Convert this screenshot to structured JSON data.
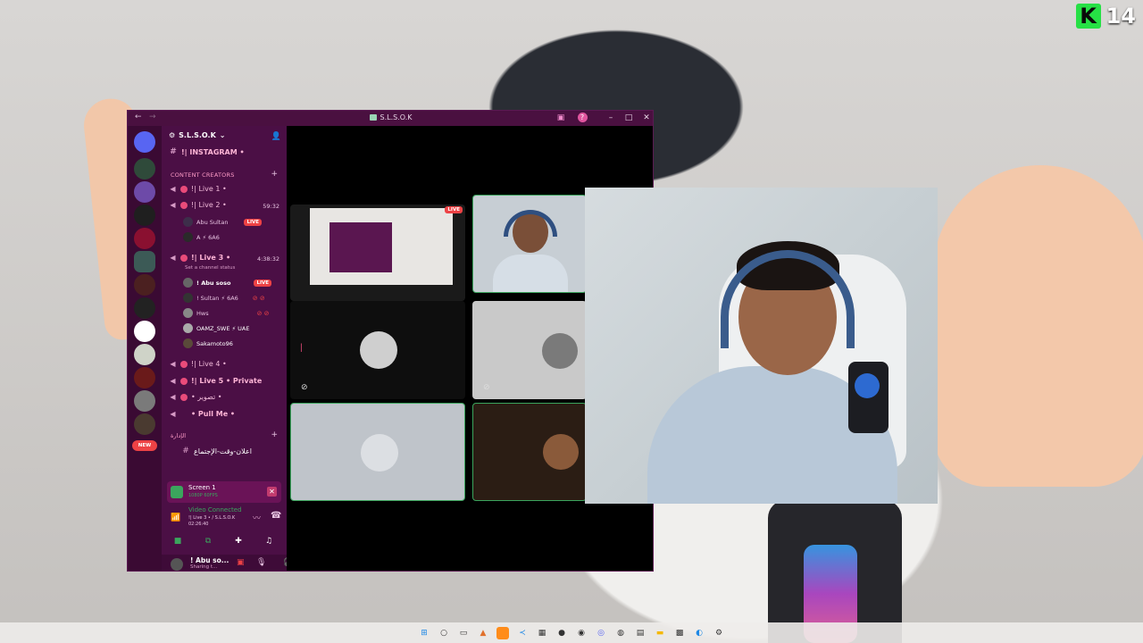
{
  "badge": {
    "logo": "K",
    "number": "14"
  },
  "window": {
    "title": "S.L.S.O.K",
    "titlebar_icons": [
      "back-arrow-icon",
      "forward-arrow-icon",
      "inbox-icon",
      "help-icon",
      "minimize-icon",
      "maximize-icon",
      "close-icon"
    ]
  },
  "sidebar": {
    "server_name": "S.L.S.O.K",
    "top_channel": "!| INSTAGRAM •",
    "categories": [
      {
        "label": "CONTENT CREATORS"
      },
      {
        "label": "الإدارة"
      }
    ],
    "voice_channels": [
      {
        "label": "!| Live 1 •",
        "timer": ""
      },
      {
        "label": "!| Live 2 •",
        "timer": "59:32",
        "users": [
          {
            "name": "Abu Sultan",
            "badge": "LIVE"
          },
          {
            "name": "A ⚡ 6A6",
            "badge": ""
          }
        ]
      },
      {
        "label": "!| Live 3 •",
        "timer": "4:38:32",
        "status": "Set a channel status",
        "users": [
          {
            "name": "! Abu soso",
            "badge": "LIVE"
          },
          {
            "name": "! Sultan ⚡ 6A6",
            "badge": ""
          },
          {
            "name": "Hws",
            "badge": ""
          },
          {
            "name": "OAMZ_SWE ⚡ UAE",
            "badge": ""
          },
          {
            "name": "Sakamoto96",
            "badge": ""
          }
        ]
      },
      {
        "label": "!| Live 4 •",
        "timer": ""
      },
      {
        "label": "!| Live 5 • Private",
        "timer": ""
      },
      {
        "label": "• تصوير •",
        "timer": ""
      },
      {
        "label": "• Pull Me •",
        "timer": ""
      }
    ],
    "text_channel_bottom": "اعلان-وقت-الإجتماع",
    "new_badge": "NEW"
  },
  "screen_share": {
    "title": "Screen 1",
    "quality": "1080P 60FPS"
  },
  "voice_status": {
    "title": "Video Connected",
    "channel": "!| Live 3 • / S.L.S.O.K",
    "elapsed": "02:26:40"
  },
  "user_panel": {
    "name": "! Abu so...",
    "status": "Sharing t..."
  },
  "stage": {
    "live_badge": "LIVE"
  },
  "colors": {
    "window_bg": "#4b0f45",
    "server_rail": "#3a0a33",
    "accent_pink": "#e94b7a",
    "live_red": "#ed4245",
    "connected_green": "#3ba55d",
    "brand_green": "#26e045"
  }
}
